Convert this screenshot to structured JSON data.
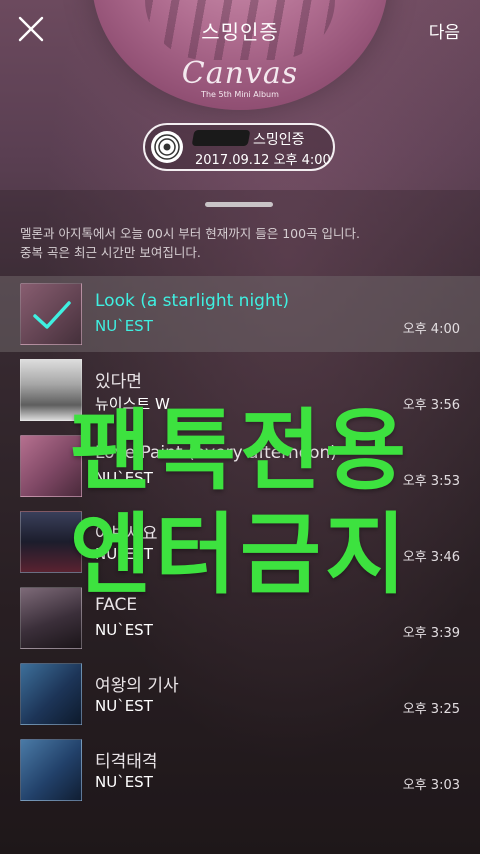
{
  "header": {
    "title": "스밍인증",
    "next_label": "다음",
    "album_logo": "Canvas",
    "album_sub": "The 5th Mini Album"
  },
  "certificate": {
    "name": "스밍인증",
    "datetime": "2017.09.12 오후 4:00"
  },
  "info": {
    "line1": "멜론과 아지톡에서 오늘 00시 부터 현재까지 들은 100곡 입니다.",
    "line2": "중복 곡은 최근 시간만 보여집니다."
  },
  "tracks": [
    {
      "title": "Look (a starlight night)",
      "artist": "NU`EST",
      "time": "오후 4:00",
      "active": true
    },
    {
      "title": "있다면",
      "artist": "뉴이스트 W",
      "time": "오후 3:56",
      "active": false
    },
    {
      "title": "Love Paint (every afternoon)",
      "artist": "NU`EST",
      "time": "오후 3:53",
      "active": false
    },
    {
      "title": "여보세요",
      "artist": "NU`EST",
      "time": "오후 3:46",
      "active": false
    },
    {
      "title": "FACE",
      "artist": "NU`EST",
      "time": "오후 3:39",
      "active": false
    },
    {
      "title": "여왕의 기사",
      "artist": "NU`EST",
      "time": "오후 3:25",
      "active": false
    },
    {
      "title": "티격태격",
      "artist": "NU`EST",
      "time": "오후 3:03",
      "active": false
    }
  ],
  "watermark": {
    "line1": "팬톡전용",
    "line2": "엔터금지"
  },
  "colors": {
    "accent": "#3ff0e1",
    "watermark": "#3de23f"
  },
  "icons": {
    "close": "close-icon",
    "disc": "disc-icon",
    "check": "check-icon"
  }
}
